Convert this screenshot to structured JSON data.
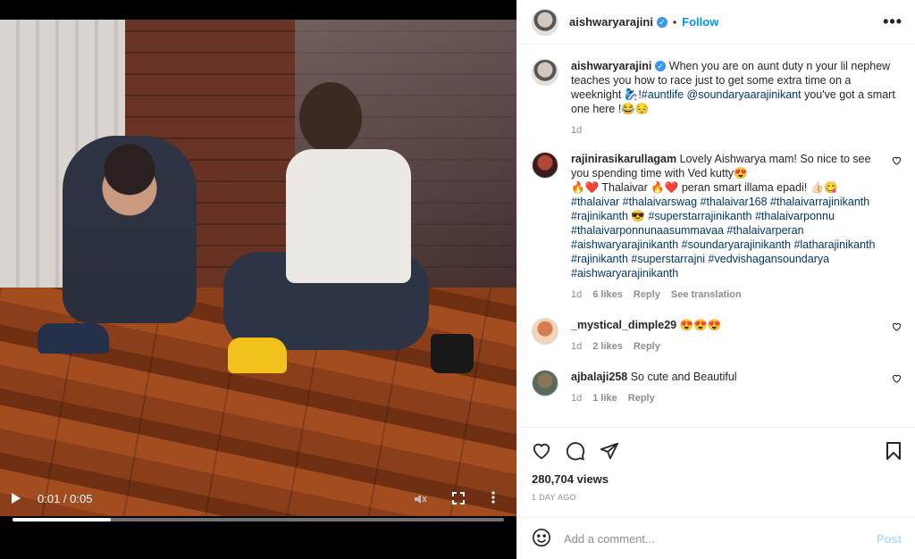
{
  "video": {
    "play_icon": "play-icon",
    "time": "0:01 / 0:05",
    "progress": 0.2,
    "icons": [
      "play-icon",
      "mute-icon",
      "fullscreen-icon",
      "more-vertical-icon"
    ]
  },
  "header": {
    "username": "aishwaryarajini",
    "verified_mark": "✓",
    "separator": "•",
    "follow_label": "Follow",
    "more_label": "•••"
  },
  "caption": {
    "username": "aishwaryarajini",
    "text_1": " When you are on aunt duty n your lil nephew teaches you how to race just to get some extra time on a weeknight 🧞‍♀️!",
    "hashtag": "#auntlife",
    "space": " ",
    "mention": "@soundaryaarajinikant",
    "text_2": " you've got a smart one here !😂😔",
    "age": "1d"
  },
  "comments": [
    {
      "username": "rajinirasikarullagam",
      "text": " Lovely Aishwarya mam! So nice to see you spending time with Ved kutty😍",
      "text_2": "🔥❤️ Thalaivar 🔥❤️ peran smart illama epadi! 👍🏻😋",
      "tags": "#thalaivar #thalaivarswag #thalaivar168 #thalaivarrajinikanth #rajinikanth 😎 #superstarrajinikanth #thalaivarponnu #thalaivarponnunaasummavaa #thalaivarperan #aishwaryarajinikanth #soundaryarajinikanth #latharajinikanth #rajinikanth #superstarrajni #vedvishagansoundarya #aishwaryarajinikanth",
      "age": "1d",
      "likes": "6 likes",
      "reply": "Reply",
      "translate": "See translation"
    },
    {
      "username": "_mystical_dimple29",
      "text": " 😍😍😍",
      "age": "1d",
      "likes": "2 likes",
      "reply": "Reply"
    },
    {
      "username": "ajbalaji258",
      "text": " So cute and Beautiful",
      "age": "1d",
      "likes": "1 like",
      "reply": "Reply"
    }
  ],
  "actions": {
    "views": "280,704 views",
    "time_ago": "1 DAY AGO"
  },
  "add_comment": {
    "placeholder": "Add a comment...",
    "post_label": "Post"
  },
  "colors": {
    "link_blue": "#0095f6",
    "hashtag": "#00376b",
    "muted": "#8e8e8e",
    "post_disabled": "#b3dbff"
  }
}
